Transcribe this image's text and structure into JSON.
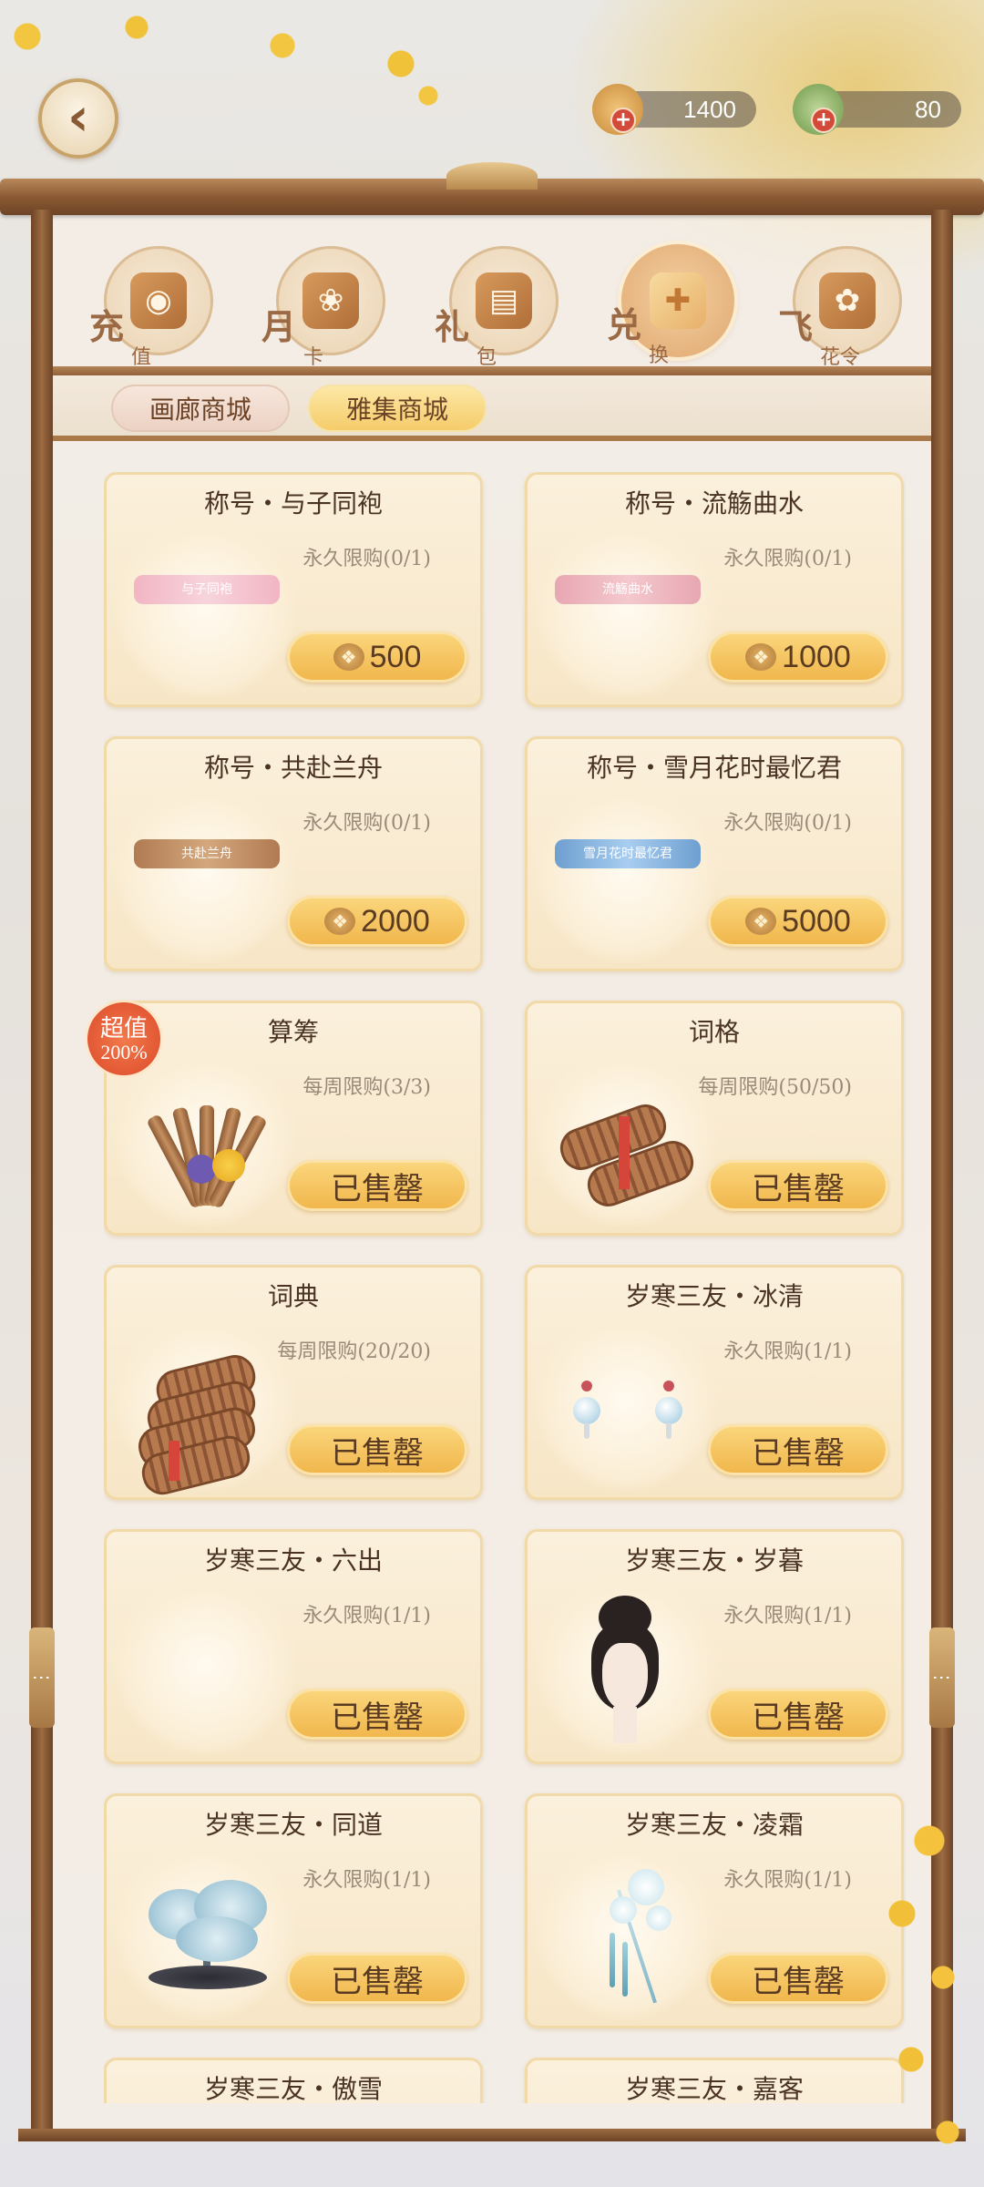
{
  "header": {
    "back_icon": "back-arrow-icon",
    "currencies": [
      {
        "name": "coin",
        "icon": "coin-icon",
        "value": "1400"
      },
      {
        "name": "leaf",
        "icon": "leaf-icon",
        "value": "80"
      }
    ]
  },
  "categories": [
    {
      "label_a": "充",
      "label_b": "值",
      "glyph": "◉",
      "icon": "recharge-icon",
      "active": false
    },
    {
      "label_a": "月",
      "label_b": "卡",
      "glyph": "❀",
      "icon": "monthly-card-icon",
      "active": false
    },
    {
      "label_a": "礼",
      "label_b": "包",
      "glyph": "▤",
      "icon": "gift-pack-icon",
      "active": false
    },
    {
      "label_a": "兑",
      "label_b": "换",
      "glyph": "✚",
      "icon": "exchange-gift-icon",
      "active": true
    },
    {
      "label_a": "飞",
      "label_b": "花令",
      "glyph": "✿",
      "icon": "flying-flower-icon",
      "active": false
    }
  ],
  "sub_tabs": [
    {
      "label": "画廊商城",
      "active": false
    },
    {
      "label": "雅集商城",
      "active": true
    }
  ],
  "badge": {
    "line1": "超值",
    "line2": "200%"
  },
  "items": [
    {
      "title": "称号・与子同袍",
      "limit": "永久限购(0/1)",
      "price": "500",
      "sold": false,
      "art": "banner-pink",
      "banner_text": "与子同袍"
    },
    {
      "title": "称号・流觞曲水",
      "limit": "永久限购(0/1)",
      "price": "1000",
      "sold": false,
      "art": "banner-rose",
      "banner_text": "流觞曲水"
    },
    {
      "title": "称号・共赴兰舟",
      "limit": "永久限购(0/1)",
      "price": "2000",
      "sold": false,
      "art": "banner-wood",
      "banner_text": "共赴兰舟"
    },
    {
      "title": "称号・雪月花时最忆君",
      "limit": "永久限购(0/1)",
      "price": "5000",
      "sold": false,
      "art": "banner-blue",
      "banner_text": "雪月花时最忆君"
    },
    {
      "title": "算筹",
      "limit": "每周限购(3/3)",
      "sold_label": "已售罄",
      "sold": true,
      "art": "scroll-bundle"
    },
    {
      "title": "词格",
      "limit": "每周限购(50/50)",
      "sold_label": "已售罄",
      "sold": true,
      "art": "rolls-2"
    },
    {
      "title": "词典",
      "limit": "每周限购(20/20)",
      "sold_label": "已售罄",
      "sold": true,
      "art": "rolls-stack"
    },
    {
      "title": "岁寒三友・冰清",
      "limit": "永久限购(1/1)",
      "sold_label": "已售罄",
      "sold": true,
      "art": "earrings"
    },
    {
      "title": "岁寒三友・六出",
      "limit": "永久限购(1/1)",
      "sold_label": "已售罄",
      "sold": true,
      "art": "none"
    },
    {
      "title": "岁寒三友・岁暮",
      "limit": "永久限购(1/1)",
      "sold_label": "已售罄",
      "sold": true,
      "art": "hairstyle"
    },
    {
      "title": "岁寒三友・同道",
      "limit": "永久限购(1/1)",
      "sold_label": "已售罄",
      "sold": true,
      "art": "bonsai"
    },
    {
      "title": "岁寒三友・凌霜",
      "limit": "永久限购(1/1)",
      "sold_label": "已售罄",
      "sold": true,
      "art": "hairpin"
    },
    {
      "title": "岁寒三友・傲雪",
      "limit": "",
      "sold": true,
      "art": "none"
    },
    {
      "title": "岁寒三友・嘉客",
      "limit": "",
      "sold": true,
      "art": "none"
    }
  ],
  "colors": {
    "frame": "#8b5a34",
    "card_bg": "#f7e6c6",
    "button_gold": "#f0b54a",
    "badge_red": "#dc4a2a"
  }
}
